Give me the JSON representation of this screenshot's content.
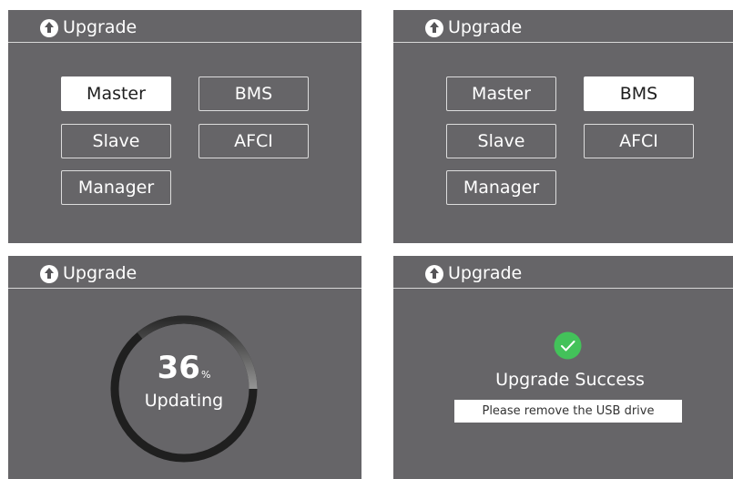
{
  "colors": {
    "panel_background": "#666568",
    "selected_button_background": "#ffffff",
    "success_green": "#43c25a"
  },
  "screens": [
    {
      "header_title": "Upgrade",
      "header_icon": "upload-arrow-icon",
      "buttons": [
        {
          "label": "Master",
          "selected": true
        },
        {
          "label": "BMS",
          "selected": false
        },
        {
          "label": "Slave",
          "selected": false
        },
        {
          "label": "AFCI",
          "selected": false
        },
        {
          "label": "Manager",
          "selected": false
        }
      ]
    },
    {
      "header_title": "Upgrade",
      "header_icon": "upload-arrow-icon",
      "buttons": [
        {
          "label": "Master",
          "selected": false
        },
        {
          "label": "BMS",
          "selected": true
        },
        {
          "label": "Slave",
          "selected": false
        },
        {
          "label": "AFCI",
          "selected": false
        },
        {
          "label": "Manager",
          "selected": false
        }
      ]
    },
    {
      "header_title": "Upgrade",
      "header_icon": "upload-arrow-icon",
      "progress": {
        "percent": 36,
        "value_text": "36",
        "unit": "%",
        "label": "Updating"
      }
    },
    {
      "header_title": "Upgrade",
      "header_icon": "upload-arrow-icon",
      "success": {
        "icon": "check-circle-icon",
        "title": "Upgrade Success",
        "message": "Please remove the USB drive"
      }
    }
  ]
}
